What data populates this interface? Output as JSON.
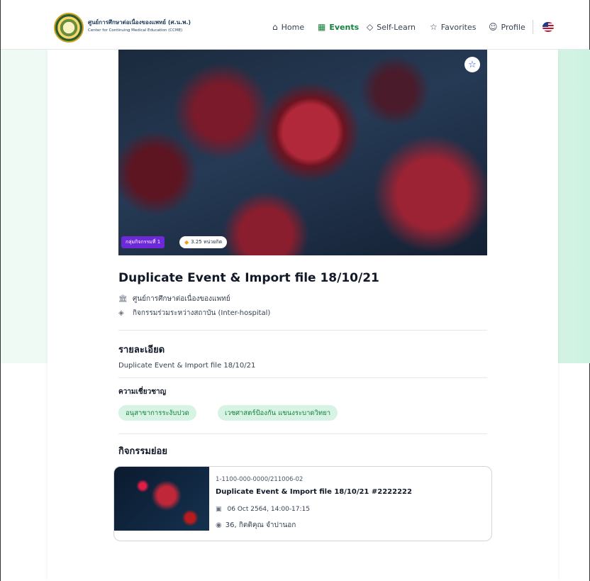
{
  "header": {
    "logo_th": "ศูนย์การศึกษาต่อเนื่องของแพทย์ (ศ.น.พ.)",
    "logo_en": "Center for Continuing Medical Education (CCME)",
    "nav": [
      {
        "label": "Home",
        "icon": "home-icon",
        "active": false
      },
      {
        "label": "Events",
        "icon": "calendar-icon",
        "active": true
      },
      {
        "label": "Self-Learn",
        "icon": "graduation-cap-icon",
        "active": false
      },
      {
        "label": "Favorites",
        "icon": "star-icon",
        "active": false
      },
      {
        "label": "Profile",
        "icon": "smile-icon",
        "active": false
      }
    ],
    "language_flag": "us-flag-icon"
  },
  "event": {
    "group_badge": "กลุ่มกิจกรรมที่ 1",
    "credit_badge": "3.25 หน่วยกิต",
    "title": "Duplicate Event & Import file 18/10/21",
    "organizer": "ศูนย์การศึกษาต่อเนื่องของแพทย์",
    "category": "กิจกรรมร่วมระหว่างสถาบัน (Inter-hospital)",
    "details_heading": "รายละเอียด",
    "details_text": "Duplicate Event & Import file 18/10/21",
    "expertise_heading": "ความเชี่ยวชาญ",
    "expertise": [
      "อนุสาขาการระงับปวด",
      "เวชศาสตร์ป้องกัน แขนงระบาดวิทยา"
    ],
    "sub_heading": "กิจกรรมย่อย"
  },
  "sub_event": {
    "code": "1-1100-000-0000/211006-02",
    "title": "Duplicate Event & Import file 18/10/21 #2222222",
    "date": "06 Oct 2564, 14:00-17:15",
    "host": "36, กิตติคุณ จำปานอก"
  },
  "colors": {
    "accent_green": "#15803d",
    "chip_bg": "#d7f3e3",
    "group_badge_bg": "#6d28d9"
  }
}
